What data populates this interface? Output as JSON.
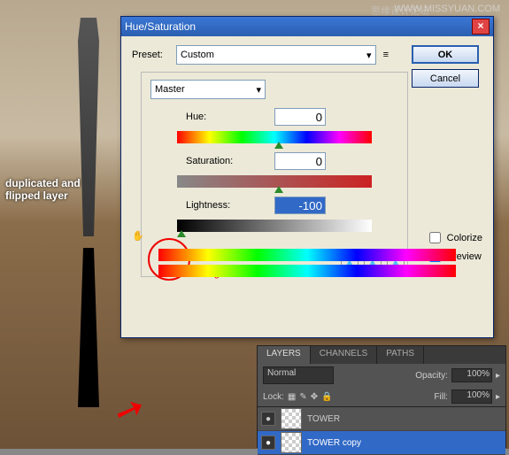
{
  "watermark": "WWW.MISSYUAN.COM",
  "watermark2": "思缘设计论坛",
  "annotation1_line1": "duplicated and",
  "annotation1_line2": "flipped layer",
  "dialog": {
    "title": "Hue/Saturation",
    "preset_label": "Preset:",
    "preset_value": "Custom",
    "ok": "OK",
    "cancel": "Cancel",
    "master": "Master",
    "hue_label": "Hue:",
    "hue_value": "0",
    "sat_label": "Saturation:",
    "sat_value": "0",
    "light_label": "Lightness:",
    "light_value": "-100",
    "red_text": "lightness reduced to 0",
    "colorize": "Colorize",
    "preview": "Preview"
  },
  "layers": {
    "tabs": [
      "LAYERS",
      "CHANNELS",
      "PATHS"
    ],
    "blend": "Normal",
    "opacity_label": "Opacity:",
    "opacity": "100%",
    "lock_label": "Lock:",
    "fill_label": "Fill:",
    "fill": "100%",
    "layer1": "TOWER",
    "layer2": "TOWER copy"
  }
}
